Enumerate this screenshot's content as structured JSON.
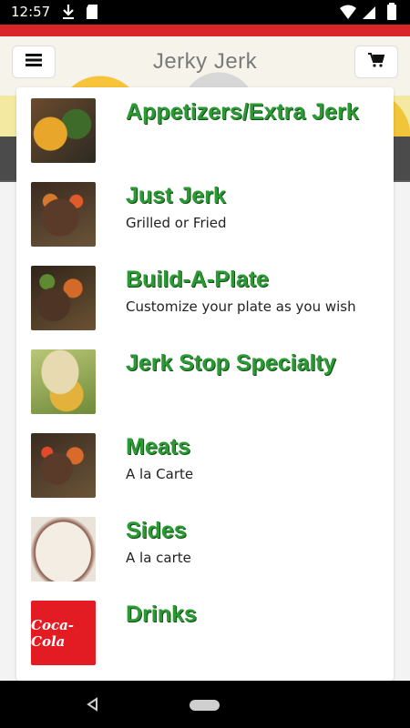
{
  "status_bar": {
    "time": "12:57"
  },
  "header": {
    "title": "Jerky Jerk"
  },
  "menu": {
    "items": [
      {
        "name": "Appetizers/Extra Jerk",
        "description": ""
      },
      {
        "name": "Just Jerk",
        "description": "Grilled or Fried"
      },
      {
        "name": "Build-A-Plate",
        "description": "Customize your plate as you wish"
      },
      {
        "name": "Jerk Stop Specialty",
        "description": ""
      },
      {
        "name": "Meats",
        "description": "A la Carte"
      },
      {
        "name": "Sides",
        "description": "A la carte"
      },
      {
        "name": "Drinks",
        "description": ""
      }
    ]
  },
  "drinks_logo_text": "Coca-Cola",
  "colors": {
    "accent_green": "#2c9a34",
    "top_strip_red": "#d9262b"
  }
}
